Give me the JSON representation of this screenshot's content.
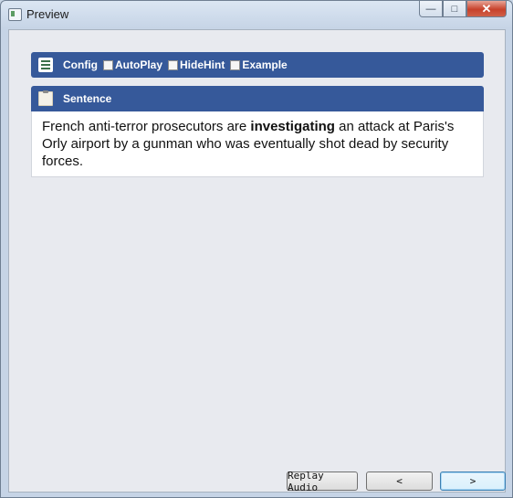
{
  "window": {
    "title": "Preview",
    "minimize_glyph": "—",
    "maximize_glyph": "□",
    "close_glyph": "✕"
  },
  "config": {
    "label": "Config",
    "checkboxes": [
      {
        "label": "AutoPlay",
        "checked": false
      },
      {
        "label": "HideHint",
        "checked": false
      },
      {
        "label": "Example",
        "checked": false
      }
    ]
  },
  "sentence": {
    "label": "Sentence",
    "text_before": "French anti-terror prosecutors are ",
    "highlight": "investigating",
    "text_after": " an attack at Paris's Orly airport by a gunman who was eventually shot dead by security forces."
  },
  "footer": {
    "replay_label": "Replay Audio",
    "prev_label": "<",
    "next_label": ">"
  },
  "colors": {
    "header_bg": "#36599a",
    "panel_bg": "#e8eaef",
    "close_red": "#c7412b"
  }
}
